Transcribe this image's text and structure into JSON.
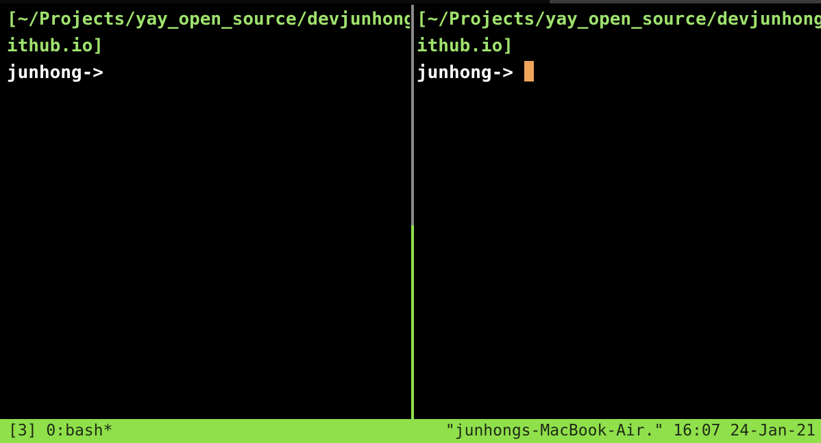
{
  "left_pane": {
    "path_line_1": "[~/Projects/yay_open_source/devjunhong.g",
    "path_line_2": "ithub.io]",
    "prompt": "junhong->"
  },
  "right_pane": {
    "path_line_1": "[~/Projects/yay_open_source/devjunhong.g",
    "path_line_2": "ithub.io]",
    "prompt": "junhong-> ",
    "active": true
  },
  "status_bar": {
    "session_index": "[3]",
    "window": "0:bash*",
    "host": "\"junhongs-MacBook-Air.\"",
    "time": "16:07",
    "date": "24-Jan-21"
  },
  "colors": {
    "background": "#000000",
    "path_text": "#9fe26e",
    "prompt_text": "#ffffff",
    "status_bar_bg": "#8fe04b",
    "cursor": "#f0a55c",
    "inactive_divider": "#8a8a8a",
    "active_divider": "#8fe04b"
  }
}
